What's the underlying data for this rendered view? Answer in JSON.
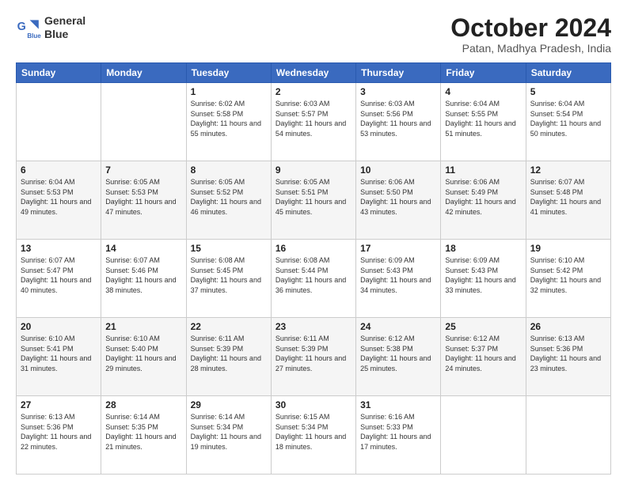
{
  "header": {
    "logo_line1": "General",
    "logo_line2": "Blue",
    "month": "October 2024",
    "location": "Patan, Madhya Pradesh, India"
  },
  "weekdays": [
    "Sunday",
    "Monday",
    "Tuesday",
    "Wednesday",
    "Thursday",
    "Friday",
    "Saturday"
  ],
  "weeks": [
    [
      {
        "day": "",
        "sunrise": "",
        "sunset": "",
        "daylight": ""
      },
      {
        "day": "",
        "sunrise": "",
        "sunset": "",
        "daylight": ""
      },
      {
        "day": "1",
        "sunrise": "Sunrise: 6:02 AM",
        "sunset": "Sunset: 5:58 PM",
        "daylight": "Daylight: 11 hours and 55 minutes."
      },
      {
        "day": "2",
        "sunrise": "Sunrise: 6:03 AM",
        "sunset": "Sunset: 5:57 PM",
        "daylight": "Daylight: 11 hours and 54 minutes."
      },
      {
        "day": "3",
        "sunrise": "Sunrise: 6:03 AM",
        "sunset": "Sunset: 5:56 PM",
        "daylight": "Daylight: 11 hours and 53 minutes."
      },
      {
        "day": "4",
        "sunrise": "Sunrise: 6:04 AM",
        "sunset": "Sunset: 5:55 PM",
        "daylight": "Daylight: 11 hours and 51 minutes."
      },
      {
        "day": "5",
        "sunrise": "Sunrise: 6:04 AM",
        "sunset": "Sunset: 5:54 PM",
        "daylight": "Daylight: 11 hours and 50 minutes."
      }
    ],
    [
      {
        "day": "6",
        "sunrise": "Sunrise: 6:04 AM",
        "sunset": "Sunset: 5:53 PM",
        "daylight": "Daylight: 11 hours and 49 minutes."
      },
      {
        "day": "7",
        "sunrise": "Sunrise: 6:05 AM",
        "sunset": "Sunset: 5:53 PM",
        "daylight": "Daylight: 11 hours and 47 minutes."
      },
      {
        "day": "8",
        "sunrise": "Sunrise: 6:05 AM",
        "sunset": "Sunset: 5:52 PM",
        "daylight": "Daylight: 11 hours and 46 minutes."
      },
      {
        "day": "9",
        "sunrise": "Sunrise: 6:05 AM",
        "sunset": "Sunset: 5:51 PM",
        "daylight": "Daylight: 11 hours and 45 minutes."
      },
      {
        "day": "10",
        "sunrise": "Sunrise: 6:06 AM",
        "sunset": "Sunset: 5:50 PM",
        "daylight": "Daylight: 11 hours and 43 minutes."
      },
      {
        "day": "11",
        "sunrise": "Sunrise: 6:06 AM",
        "sunset": "Sunset: 5:49 PM",
        "daylight": "Daylight: 11 hours and 42 minutes."
      },
      {
        "day": "12",
        "sunrise": "Sunrise: 6:07 AM",
        "sunset": "Sunset: 5:48 PM",
        "daylight": "Daylight: 11 hours and 41 minutes."
      }
    ],
    [
      {
        "day": "13",
        "sunrise": "Sunrise: 6:07 AM",
        "sunset": "Sunset: 5:47 PM",
        "daylight": "Daylight: 11 hours and 40 minutes."
      },
      {
        "day": "14",
        "sunrise": "Sunrise: 6:07 AM",
        "sunset": "Sunset: 5:46 PM",
        "daylight": "Daylight: 11 hours and 38 minutes."
      },
      {
        "day": "15",
        "sunrise": "Sunrise: 6:08 AM",
        "sunset": "Sunset: 5:45 PM",
        "daylight": "Daylight: 11 hours and 37 minutes."
      },
      {
        "day": "16",
        "sunrise": "Sunrise: 6:08 AM",
        "sunset": "Sunset: 5:44 PM",
        "daylight": "Daylight: 11 hours and 36 minutes."
      },
      {
        "day": "17",
        "sunrise": "Sunrise: 6:09 AM",
        "sunset": "Sunset: 5:43 PM",
        "daylight": "Daylight: 11 hours and 34 minutes."
      },
      {
        "day": "18",
        "sunrise": "Sunrise: 6:09 AM",
        "sunset": "Sunset: 5:43 PM",
        "daylight": "Daylight: 11 hours and 33 minutes."
      },
      {
        "day": "19",
        "sunrise": "Sunrise: 6:10 AM",
        "sunset": "Sunset: 5:42 PM",
        "daylight": "Daylight: 11 hours and 32 minutes."
      }
    ],
    [
      {
        "day": "20",
        "sunrise": "Sunrise: 6:10 AM",
        "sunset": "Sunset: 5:41 PM",
        "daylight": "Daylight: 11 hours and 31 minutes."
      },
      {
        "day": "21",
        "sunrise": "Sunrise: 6:10 AM",
        "sunset": "Sunset: 5:40 PM",
        "daylight": "Daylight: 11 hours and 29 minutes."
      },
      {
        "day": "22",
        "sunrise": "Sunrise: 6:11 AM",
        "sunset": "Sunset: 5:39 PM",
        "daylight": "Daylight: 11 hours and 28 minutes."
      },
      {
        "day": "23",
        "sunrise": "Sunrise: 6:11 AM",
        "sunset": "Sunset: 5:39 PM",
        "daylight": "Daylight: 11 hours and 27 minutes."
      },
      {
        "day": "24",
        "sunrise": "Sunrise: 6:12 AM",
        "sunset": "Sunset: 5:38 PM",
        "daylight": "Daylight: 11 hours and 25 minutes."
      },
      {
        "day": "25",
        "sunrise": "Sunrise: 6:12 AM",
        "sunset": "Sunset: 5:37 PM",
        "daylight": "Daylight: 11 hours and 24 minutes."
      },
      {
        "day": "26",
        "sunrise": "Sunrise: 6:13 AM",
        "sunset": "Sunset: 5:36 PM",
        "daylight": "Daylight: 11 hours and 23 minutes."
      }
    ],
    [
      {
        "day": "27",
        "sunrise": "Sunrise: 6:13 AM",
        "sunset": "Sunset: 5:36 PM",
        "daylight": "Daylight: 11 hours and 22 minutes."
      },
      {
        "day": "28",
        "sunrise": "Sunrise: 6:14 AM",
        "sunset": "Sunset: 5:35 PM",
        "daylight": "Daylight: 11 hours and 21 minutes."
      },
      {
        "day": "29",
        "sunrise": "Sunrise: 6:14 AM",
        "sunset": "Sunset: 5:34 PM",
        "daylight": "Daylight: 11 hours and 19 minutes."
      },
      {
        "day": "30",
        "sunrise": "Sunrise: 6:15 AM",
        "sunset": "Sunset: 5:34 PM",
        "daylight": "Daylight: 11 hours and 18 minutes."
      },
      {
        "day": "31",
        "sunrise": "Sunrise: 6:16 AM",
        "sunset": "Sunset: 5:33 PM",
        "daylight": "Daylight: 11 hours and 17 minutes."
      },
      {
        "day": "",
        "sunrise": "",
        "sunset": "",
        "daylight": ""
      },
      {
        "day": "",
        "sunrise": "",
        "sunset": "",
        "daylight": ""
      }
    ]
  ]
}
